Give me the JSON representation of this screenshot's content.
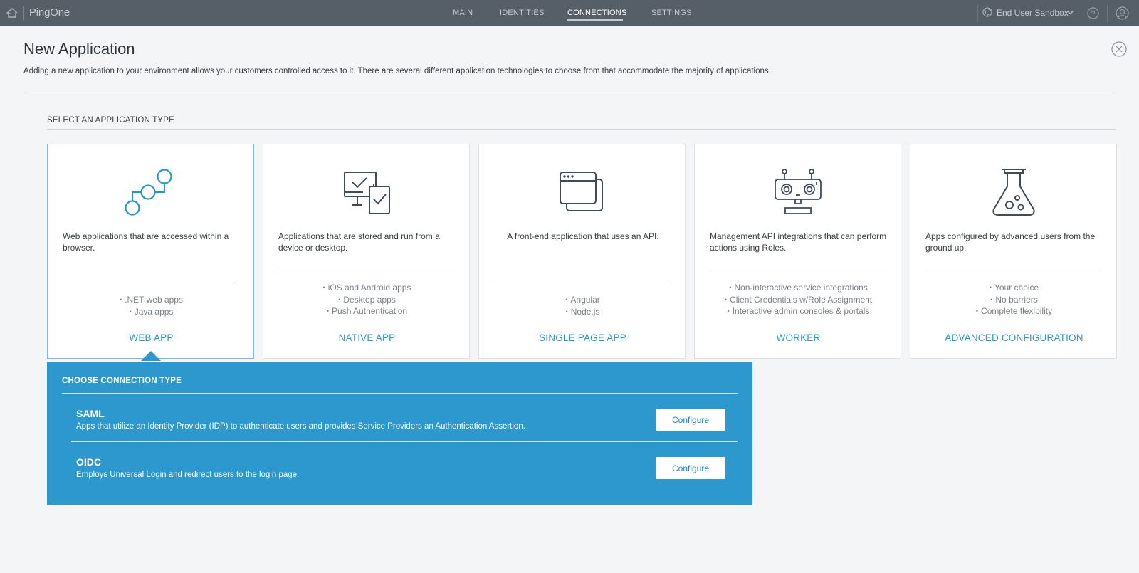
{
  "topbar": {
    "logo": "PingOne",
    "nav": [
      {
        "label": "MAIN",
        "active": false
      },
      {
        "label": "IDENTITIES",
        "active": false
      },
      {
        "label": "CONNECTIONS",
        "active": true
      },
      {
        "label": "SETTINGS",
        "active": false
      }
    ],
    "environment": "End User Sandbox",
    "icons": [
      "home-icon",
      "globe-icon",
      "chevron-down-icon",
      "help-icon",
      "user-icon"
    ]
  },
  "header": {
    "title": "New Application",
    "description": "Adding a new application to your environment allows your customers controlled access to it. There are several different application technologies to choose from that accommodate the majority of applications."
  },
  "section": {
    "label": "SELECT AN APPLICATION TYPE"
  },
  "cards": [
    {
      "icon": "web-app-nodes-icon",
      "description": "Web applications that are accessed within a browser.",
      "bullets": [
        ".NET web apps",
        "Java apps"
      ],
      "type": "WEB APP",
      "selected": true
    },
    {
      "icon": "native-app-devices-icon",
      "description": "Applications that are stored and run from a device or desktop.",
      "bullets": [
        "iOS and Android apps",
        "Desktop apps",
        "Push Authentication"
      ],
      "type": "NATIVE APP",
      "selected": false
    },
    {
      "icon": "single-page-app-windows-icon",
      "description": "A front-end application that uses an API.",
      "bullets": [
        "Angular",
        "Node.js"
      ],
      "type": "SINGLE PAGE APP",
      "selected": false
    },
    {
      "icon": "worker-robot-icon",
      "description": "Management API integrations that can perform actions using Roles.",
      "bullets": [
        "Non-interactive service integrations",
        "Client Credentials w/Role Assignment",
        "Interactive admin consoles & portals"
      ],
      "type": "WORKER",
      "selected": false
    },
    {
      "icon": "advanced-flask-icon",
      "description": "Apps configured by advanced users from the ground up.",
      "bullets": [
        "Your choice",
        "No barriers",
        "Complete flexibility"
      ],
      "type": "ADVANCED CONFIGURATION",
      "selected": false
    }
  ],
  "connection_panel": {
    "title": "CHOOSE CONNECTION TYPE",
    "options": [
      {
        "name": "SAML",
        "description": "Apps that utilize an Identity Provider (IDP) to authenticate users and provides Service Providers an Authentication Assertion.",
        "button": "Configure"
      },
      {
        "name": "OIDC",
        "description": "Employs Universal Login and redirect users to the login page.",
        "button": "Configure"
      }
    ]
  },
  "colors": {
    "topbar": "#565f68",
    "accent": "#2a95c9",
    "panel": "#2c98cd",
    "icon_stroke": "#3d4b5a"
  }
}
